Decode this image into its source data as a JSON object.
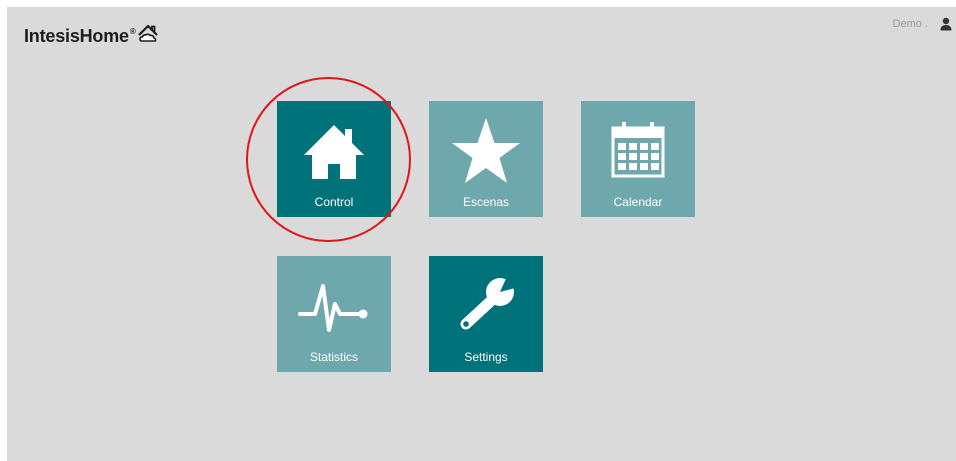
{
  "header": {
    "logo_text": "IntesisHome",
    "logo_reg": "®",
    "user_name": "Demo ."
  },
  "tiles": [
    {
      "label": "Control",
      "icon": "home-icon",
      "state": "active"
    },
    {
      "label": "Escenas",
      "icon": "star-icon",
      "state": "inactive"
    },
    {
      "label": "Calendar",
      "icon": "calendar-icon",
      "state": "inactive"
    },
    {
      "label": "Statistics",
      "icon": "statistics-icon",
      "state": "inactive"
    },
    {
      "label": "Settings",
      "icon": "wrench-icon",
      "state": "active"
    }
  ],
  "colors": {
    "background": "#dadada",
    "tile_active": "#00727a",
    "tile_inactive": "#6ea8ad",
    "highlight": "#e3141a"
  }
}
